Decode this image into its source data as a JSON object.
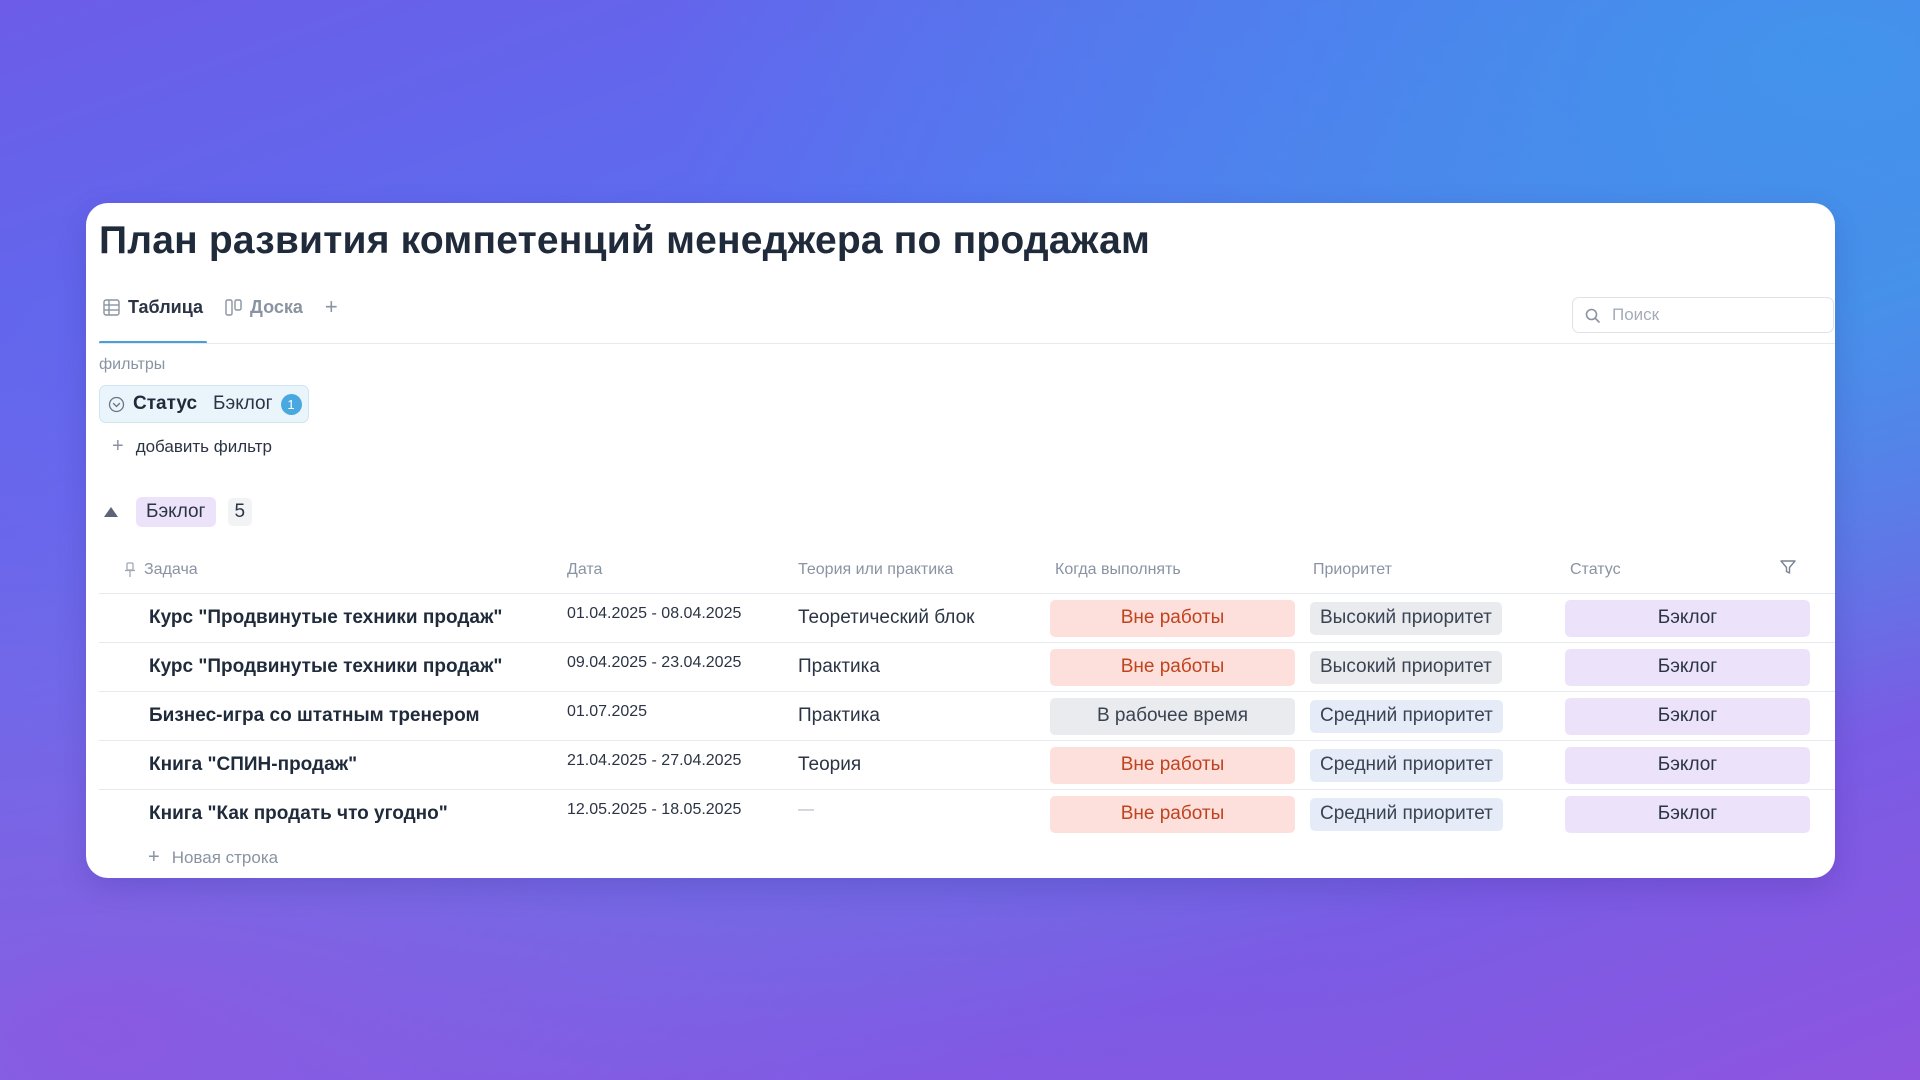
{
  "page": {
    "title": "План развития компетенций менеджера по продажам"
  },
  "tabs": [
    {
      "label": "Таблица",
      "icon": "table-icon",
      "active": true
    },
    {
      "label": "Доска",
      "icon": "board-icon",
      "active": false
    }
  ],
  "tabs_add": "+",
  "search": {
    "placeholder": "Поиск",
    "value": ""
  },
  "filters": {
    "label": "фильтры",
    "items": [
      {
        "name": "Статус",
        "value": "Бэклог",
        "count": "1"
      }
    ],
    "add_label": "добавить фильтр"
  },
  "group": {
    "name": "Бэклог",
    "count": "5"
  },
  "columns": {
    "task": "Задача",
    "date": "Дата",
    "type": "Теория или практика",
    "when": "Когда выполнять",
    "priority": "Приоритет",
    "status": "Статус"
  },
  "rows": [
    {
      "task": "Курс \"Продвинутые техники продаж\"",
      "date": "01.04.2025 - 08.04.2025",
      "type": "Теоретический блок",
      "when": "Вне работы",
      "priority": "Высокий приоритет",
      "status": "Бэклог"
    },
    {
      "task": "Курс \"Продвинутые техники продаж\"",
      "date": "09.04.2025 - 23.04.2025",
      "type": "Практика",
      "when": "Вне работы",
      "priority": "Высокий приоритет",
      "status": "Бэклог"
    },
    {
      "task": "Бизнес-игра со штатным тренером",
      "date": "01.07.2025",
      "type": "Практика",
      "when": "В рабочее время",
      "priority": "Средний приоритет",
      "status": "Бэклог"
    },
    {
      "task": "Книга \"СПИН-продаж\"",
      "date": "21.04.2025 - 27.04.2025",
      "type": "Теория",
      "when": "Вне работы",
      "priority": "Средний приоритет",
      "status": "Бэклог"
    },
    {
      "task": "Книга \"Как продать что угодно\"",
      "date": "12.05.2025 - 18.05.2025",
      "type": "—",
      "when": "Вне работы",
      "priority": "Средний приоритет",
      "status": "Бэклог"
    }
  ],
  "new_row_label": "Новая строка",
  "colors": {
    "accent": "#4a9fd8",
    "off_work_bg": "#fde0db",
    "off_work_text": "#c0431f",
    "status_bg": "#ece3fb"
  }
}
